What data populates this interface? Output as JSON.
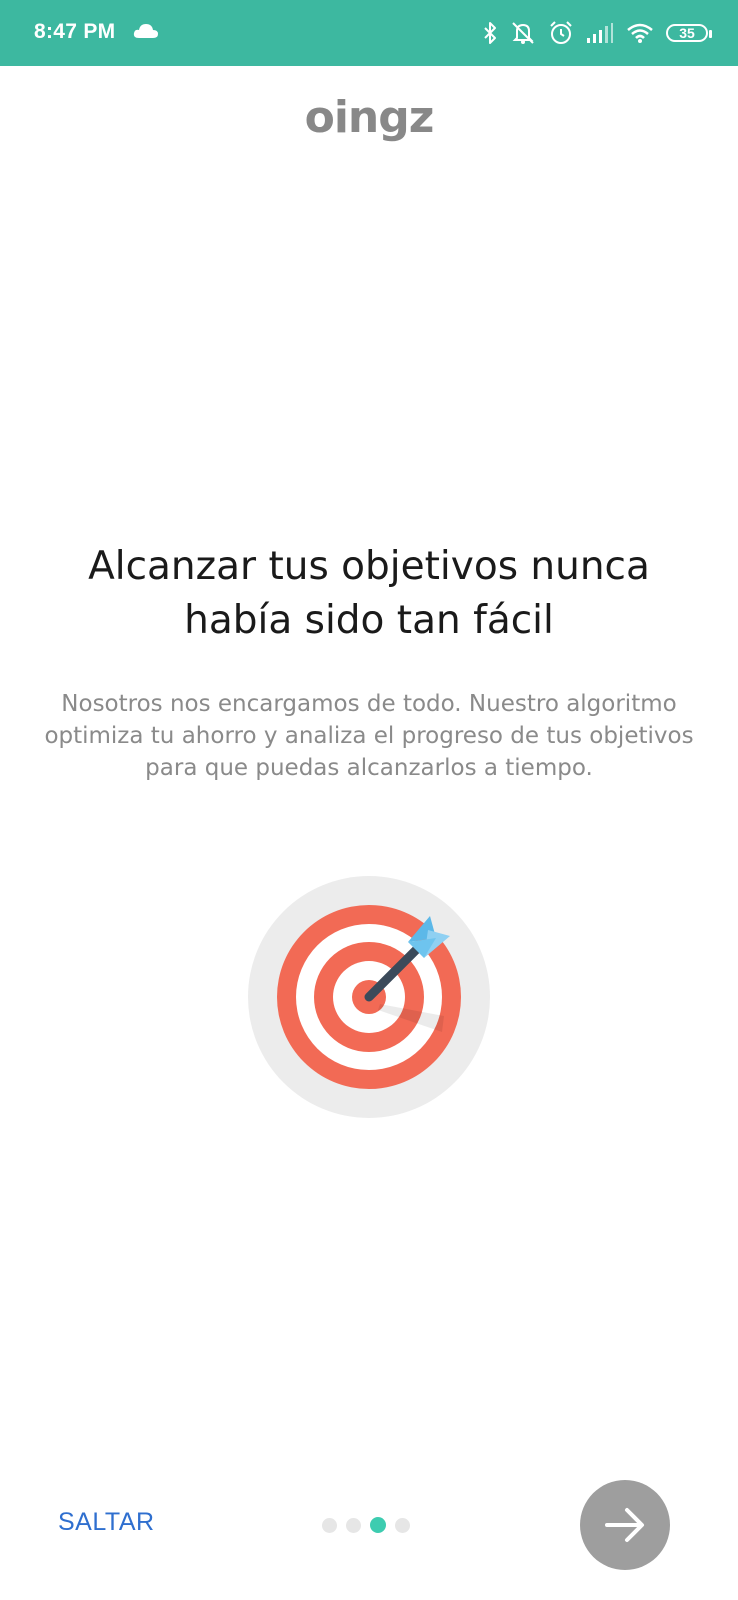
{
  "status_bar": {
    "time": "8:47 PM",
    "battery": "35",
    "background_color": "#3db8a0",
    "icons": [
      "cloud-icon",
      "bluetooth-icon",
      "notifications-off-icon",
      "alarm-icon",
      "signal-icon",
      "wifi-icon",
      "battery-icon"
    ]
  },
  "app": {
    "logo_text": "oingz"
  },
  "onboarding": {
    "title": "Alcanzar tus objetivos nunca había sido tan fácil",
    "description": "Nosotros nos encargamos de todo. Nuestro algoritmo optimiza tu ahorro y analiza el progreso de tus objetivos para que puedas alcanzarlos a tiempo.",
    "illustration": "target-with-arrow-icon"
  },
  "footer": {
    "skip_label": "SALTAR",
    "page_count": 4,
    "current_page": 3,
    "next_icon": "arrow-right-icon",
    "accent_color": "#3dccb0",
    "skip_color": "#2f6fcf"
  }
}
